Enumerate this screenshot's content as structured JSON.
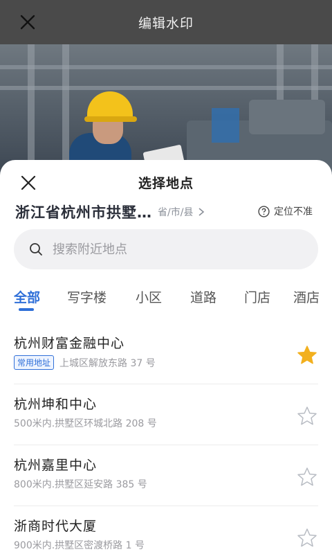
{
  "topbar": {
    "title": "编辑水印"
  },
  "sheet": {
    "title": "选择地点",
    "current_location": "浙江省杭州市拱墅…",
    "region_label": "省/市/县",
    "inaccurate_label": "定位不准",
    "search_placeholder": "搜索附近地点",
    "tabs": [
      "全部",
      "写字楼",
      "小区",
      "道路",
      "门店",
      "酒店"
    ],
    "active_tab": "全部",
    "places": [
      {
        "name": "杭州财富金融中心",
        "badge": "常用地址",
        "address": "上城区解放东路 37 号",
        "favorite": true
      },
      {
        "name": "杭州坤和中心",
        "badge": "",
        "address": "500米内.拱墅区环城北路 208 号",
        "favorite": false
      },
      {
        "name": "杭州嘉里中心",
        "badge": "",
        "address": "800米内.拱墅区延安路 385 号",
        "favorite": false
      },
      {
        "name": "浙商时代大厦",
        "badge": "",
        "address": "900米内.拱墅区密渡桥路 1 号",
        "favorite": false
      }
    ]
  },
  "colors": {
    "accent": "#2f6fd8",
    "star_filled": "#f2b01e",
    "star_outline": "#b8bcc3"
  },
  "icons": {
    "close": "close-icon",
    "search": "search-icon",
    "help": "question-circle-icon",
    "chevron": "chevron-right-icon",
    "star": "star-icon"
  }
}
